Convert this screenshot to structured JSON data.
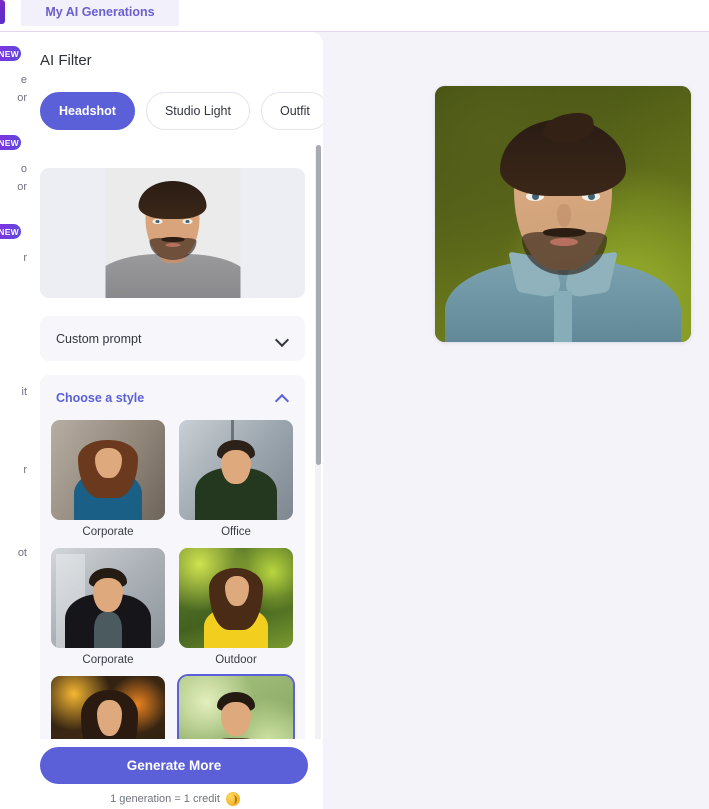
{
  "top_bar": {
    "tab_label": "My AI Generations"
  },
  "left_rail": {
    "items": [
      {
        "badge": "NEW",
        "text_fragment_1": "e",
        "text_fragment_2": "or"
      },
      {
        "badge": "NEW",
        "text_fragment_1": "o",
        "text_fragment_2": "or"
      },
      {
        "badge": "NEW",
        "text_fragment_1": "",
        "text_fragment_2": "r"
      },
      {
        "badge": "",
        "text_fragment_1": "",
        "text_fragment_2": "it"
      },
      {
        "badge": "",
        "text_fragment_1": "",
        "text_fragment_2": "r"
      },
      {
        "badge": "",
        "text_fragment_1": "",
        "text_fragment_2": "ot"
      }
    ]
  },
  "panel": {
    "title": "AI Filter",
    "filter_tabs": [
      {
        "label": "Headshot",
        "active": true
      },
      {
        "label": "Studio Light",
        "active": false
      },
      {
        "label": "Outfit",
        "active": false
      }
    ],
    "custom_prompt": {
      "label": "Custom prompt",
      "expanded": false,
      "chevron": "chevron-down-icon"
    },
    "choose_style": {
      "label": "Choose a style",
      "expanded": true,
      "chevron": "chevron-up-icon",
      "styles": [
        {
          "label": "Corporate",
          "scene": "corporate-female",
          "selected": false
        },
        {
          "label": "Office",
          "scene": "office-male",
          "selected": false
        },
        {
          "label": "Corporate",
          "scene": "city-male",
          "selected": false
        },
        {
          "label": "Outdoor",
          "scene": "outdoor-female",
          "selected": false
        },
        {
          "label": "",
          "scene": "night-female",
          "selected": false
        },
        {
          "label": "",
          "scene": "garden-male",
          "selected": true
        }
      ]
    },
    "generate_button": "Generate More",
    "credit_note": "1 generation = 1 credit",
    "scrollbar": {
      "thumb_top_pct": 0,
      "thumb_height_pct": 51
    }
  },
  "colors": {
    "accent": "#5c60d8",
    "accent_text": "#6b5fd0",
    "canvas_bg": "#f4f3f9",
    "panel_bg": "#ffffff",
    "section_bg": "#f6f6fb",
    "divider": "#e2d5ef",
    "badge_gradient_start": "#8a2be2",
    "badge_gradient_end": "#5b4bdb",
    "coin": "#eaa310"
  }
}
